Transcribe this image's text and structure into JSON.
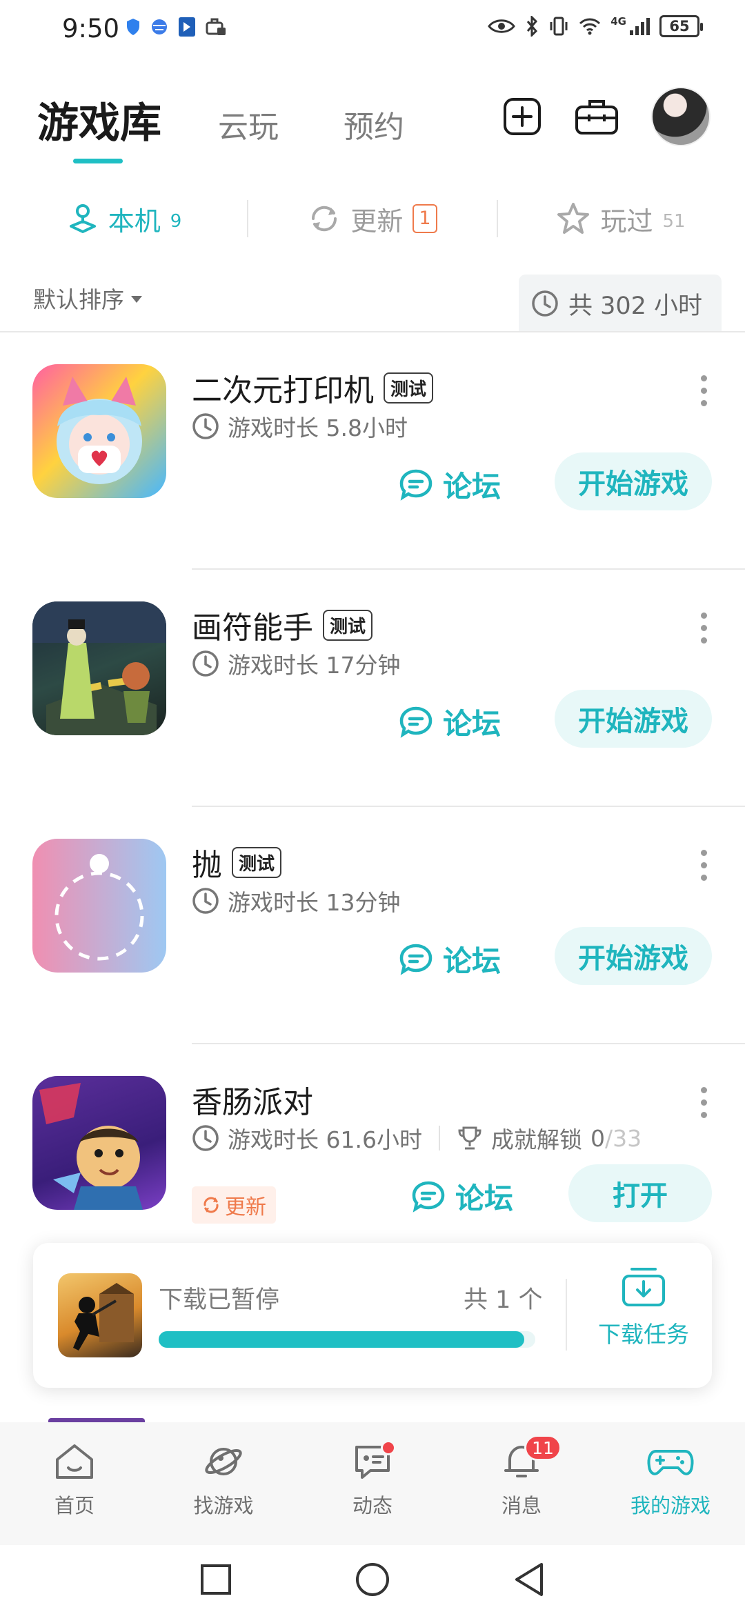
{
  "status_bar": {
    "time": "9:50",
    "network": "4G",
    "battery": "65"
  },
  "header": {
    "tabs": [
      {
        "label": "游戏库",
        "active": true
      },
      {
        "label": "云玩",
        "active": false
      },
      {
        "label": "预约",
        "active": false
      }
    ],
    "icons": [
      "add-icon",
      "toolbox-icon",
      "avatar"
    ]
  },
  "filters": [
    {
      "label": "本机",
      "count": "9",
      "icon": "joystick-icon",
      "active": true
    },
    {
      "label": "更新",
      "count": "1",
      "icon": "refresh-icon",
      "active": false
    },
    {
      "label": "玩过",
      "count": "51",
      "icon": "star-icon",
      "active": false
    }
  ],
  "sort": {
    "label": "默认排序"
  },
  "total_playtime": "共 302 小时",
  "games": [
    {
      "title": "二次元打印机",
      "tag": "测试",
      "playtime": "游戏时长 5.8小时",
      "forum": "论坛",
      "action": "开始游戏"
    },
    {
      "title": "画符能手",
      "tag": "测试",
      "playtime": "游戏时长 17分钟",
      "forum": "论坛",
      "action": "开始游戏"
    },
    {
      "title": "抛",
      "tag": "测试",
      "playtime": "游戏时长 13分钟",
      "forum": "论坛",
      "action": "开始游戏"
    },
    {
      "title": "香肠派对",
      "tag": "",
      "playtime": "游戏时长 61.6小时",
      "achievement_label": "成就解锁",
      "achievement_unlocked": "0",
      "achievement_total": "/33",
      "update_label": "更新",
      "forum": "论坛",
      "action": "打开"
    }
  ],
  "download": {
    "status": "下载已暂停",
    "count": "共 1 个",
    "progress": 0.97,
    "task_label": "下载任务"
  },
  "bottom_nav": [
    {
      "label": "首页",
      "icon": "home-icon"
    },
    {
      "label": "找游戏",
      "icon": "planet-icon"
    },
    {
      "label": "动态",
      "icon": "chat-icon"
    },
    {
      "label": "消息",
      "icon": "bell-icon",
      "badge": "11"
    },
    {
      "label": "我的游戏",
      "icon": "gamepad-icon",
      "active": true
    }
  ],
  "colors": {
    "accent": "#1fbfc4",
    "update": "#ef7a4b",
    "badge": "#f0444a"
  }
}
